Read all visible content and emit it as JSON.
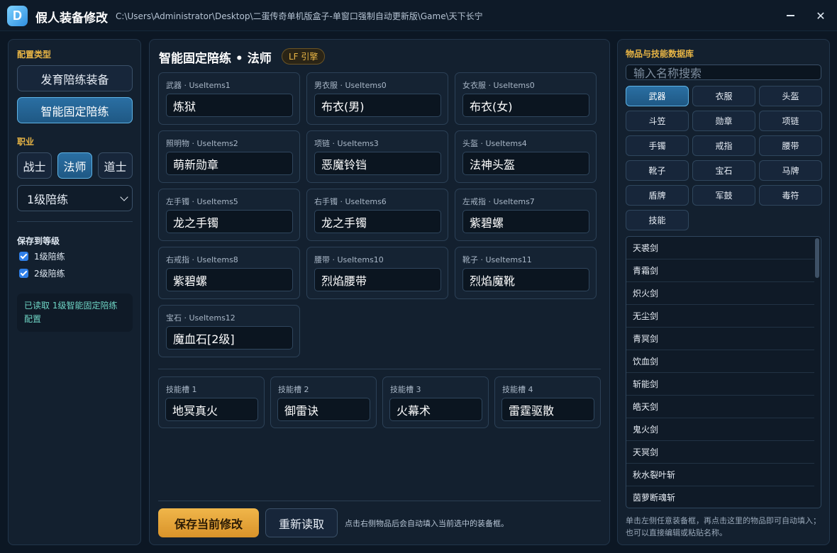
{
  "app": {
    "logo_letter": "D",
    "title": "假人装备修改",
    "path": "C:\\Users\\Administrator\\Desktop\\二蛋传奇单机版盒子-单窗口强制自动更新版\\Game\\天下长宁"
  },
  "left": {
    "config_type_label": "配置类型",
    "config_buttons": [
      "发育陪练装备",
      "智能固定陪练"
    ],
    "active_config": 1,
    "profession_label": "职业",
    "professions": [
      "战士",
      "法师",
      "道士"
    ],
    "active_profession": 1,
    "level_select": "1级陪练",
    "save_to_label": "保存到等级",
    "save_levels": [
      {
        "label": "1级陪练",
        "checked": true
      },
      {
        "label": "2级陪练",
        "checked": true
      }
    ],
    "status": "已读取 1级智能固定陪练配置"
  },
  "main": {
    "title": "智能固定陪练 • 法师",
    "badge": "LF 引擎",
    "slots": [
      {
        "label": "武器 · UseItems1",
        "value": "炼狱"
      },
      {
        "label": "男衣服 · UseItems0",
        "value": "布衣(男)"
      },
      {
        "label": "女衣服 · UseItems0",
        "value": "布衣(女)"
      },
      {
        "label": "照明物 · UseItems2",
        "value": "萌新勋章"
      },
      {
        "label": "项链 · UseItems3",
        "value": "恶魔铃铛"
      },
      {
        "label": "头盔 · UseItems4",
        "value": "法神头盔"
      },
      {
        "label": "左手镯 · UseItems5",
        "value": "龙之手镯"
      },
      {
        "label": "右手镯 · UseItems6",
        "value": "龙之手镯"
      },
      {
        "label": "左戒指 · UseItems7",
        "value": "紫碧螺"
      },
      {
        "label": "右戒指 · UseItems8",
        "value": "紫碧螺"
      },
      {
        "label": "腰带 · UseItems10",
        "value": "烈焰腰带"
      },
      {
        "label": "靴子 · UseItems11",
        "value": "烈焰魔靴"
      },
      {
        "label": "宝石 · UseItems12",
        "value": "魔血石[2级]"
      }
    ],
    "skills": [
      {
        "label": "技能槽 1",
        "value": "地冥真火"
      },
      {
        "label": "技能槽 2",
        "value": "御雷诀"
      },
      {
        "label": "技能槽 3",
        "value": "火幕术"
      },
      {
        "label": "技能槽 4",
        "value": "雷霆驱散"
      }
    ],
    "save_button": "保存当前修改",
    "reload_button": "重新读取",
    "hint": "点击右侧物品后会自动填入当前选中的装备框。"
  },
  "right": {
    "title": "物品与技能数据库",
    "search_placeholder": "输入名称搜索",
    "categories": [
      "武器",
      "衣服",
      "头盔",
      "斗笠",
      "勋章",
      "项链",
      "手镯",
      "戒指",
      "腰带",
      "靴子",
      "宝石",
      "马牌",
      "盾牌",
      "军鼓",
      "毒符",
      "技能"
    ],
    "active_category": 0,
    "items": [
      "天裘剑",
      "青霜剑",
      "炽火剑",
      "无尘剑",
      "青冥剑",
      "饮血剑",
      "斩能剑",
      "皓天剑",
      "鬼火剑",
      "天冥剑",
      "秋水裂叶斩",
      "茵萝断魂斩"
    ],
    "hint": "单击左侧任意装备框，再点击这里的物品即可自动填入；也可以直接编辑或粘贴名称。"
  },
  "colors": {
    "accent_gold": "#e8b545",
    "accent_blue": "#2a6fa3",
    "status_teal": "#6fd6c6",
    "background": "#0c1724"
  }
}
